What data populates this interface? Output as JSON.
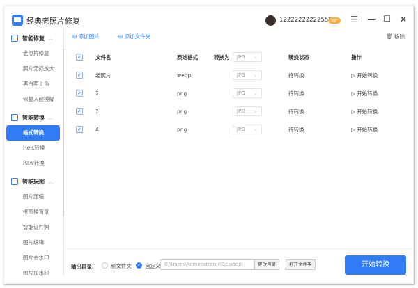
{
  "app": {
    "title": "经典老照片修复",
    "user": "12222222222555",
    "vip": "VIP"
  },
  "sidebar": {
    "sections": [
      {
        "label": "智能修复",
        "items": [
          "老照片修复",
          "照片无损放大",
          "黑白照上色",
          "修复人脸模糊"
        ]
      },
      {
        "label": "智能转换",
        "items": [
          "格式转换",
          "Heic转换",
          "Raw转换"
        ]
      },
      {
        "label": "智能玩图",
        "items": [
          "图片压缩",
          "抠图换背景",
          "智能证件照",
          "图片编辑",
          "图片去水印",
          "图片加水印"
        ]
      }
    ],
    "active": "格式转换"
  },
  "toolbar": {
    "add_image": "添加图片",
    "add_folder": "添加文件夹",
    "remove": "移除"
  },
  "table": {
    "headers": {
      "name": "文件名",
      "format": "原始格式",
      "convert_to": "转换为",
      "status": "转换状态",
      "action": "操作"
    },
    "header_select": "JPG",
    "rows": [
      {
        "name": "老照片",
        "format": "webp",
        "target": "JPG",
        "status": "待转换",
        "action": "开始转换"
      },
      {
        "name": "2",
        "format": "png",
        "target": "JPG",
        "status": "待转换",
        "action": "开始转换"
      },
      {
        "name": "3",
        "format": "png",
        "target": "JPG",
        "status": "待转换",
        "action": "开始转换"
      },
      {
        "name": "4",
        "format": "png",
        "target": "JPG",
        "status": "待转换",
        "action": "开始转换"
      }
    ]
  },
  "output": {
    "label": "输出目录:",
    "opt_original": "原文件夹",
    "opt_custom": "自定义",
    "path": "C:\\Users\\Administrator\\Desktop\\",
    "change_dir": "更改目录",
    "open_folder": "打开文件夹",
    "start": "开始转换"
  },
  "colors": {
    "accent": "#2f7cf6",
    "vip": "#f7b046"
  }
}
